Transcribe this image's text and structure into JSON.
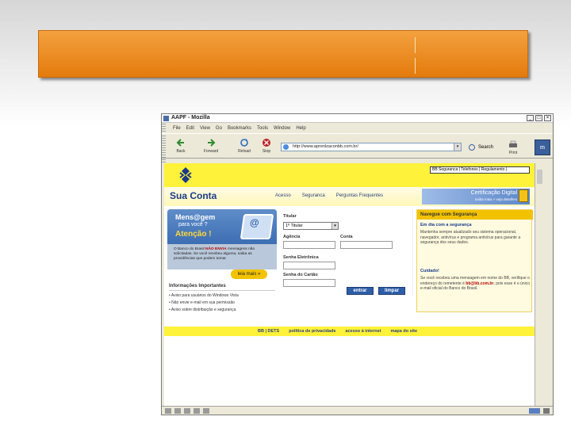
{
  "browser": {
    "title": "AAPF - Mozilla",
    "menu": [
      "File",
      "Edit",
      "View",
      "Go",
      "Bookmarks",
      "Tools",
      "Window",
      "Help"
    ],
    "toolbar": {
      "back": "Back",
      "forward": "Forward",
      "reload": "Reload",
      "stop": "Stop",
      "print": "Print"
    },
    "url": "http://www.aprenlzaconbb.com.br/",
    "search_label": "Search",
    "throbber": "m"
  },
  "page": {
    "top_link": "BB Seguranca | Telefones | Regulamento |",
    "brand": "Sua Conta",
    "nav": [
      "Acesso",
      "Seguranca",
      "Perguntas Frequentes"
    ],
    "cert_title": "Certificação Digital",
    "cert_sub": "saiba mais  »  veja detalhes",
    "promo": {
      "title": "Mens@gem",
      "subtitle": "para você ?",
      "alert": "Atenção !",
      "body_pre": "O Banco do Brasil ",
      "body_bold": "NÃO ENVIA",
      "body_post": " mensagens não solicitadas. Se você recebeu alguma, saiba as providências que podem tomar."
    },
    "leia_mais": "leia mais  »",
    "info_heading": "Informações Importantes",
    "info_items": [
      "• Aviso para usuários do Windows Vista",
      "• Não envie e-mail em sua permissão",
      "• Aviso sobre distribuição e segurança"
    ],
    "form": {
      "titular_label": "Titular",
      "titular_value": "1º Titular",
      "agencia_label": "Agência",
      "conta_label": "Conta",
      "senha_label": "Senha Eletrônica",
      "senha_cartao_label": "Senha do Cartão",
      "entrar": "entrar",
      "limpar": "limpar"
    },
    "right_panel": {
      "header": "Navegue com Segurança",
      "s1": "Em dia com a segurança",
      "t1": "Mantenha sempre atualizado seu sistema operacional, navegador, antivírus e programa antivírus para garantir a segurança dos seus dados.",
      "s2": "Cuidado!",
      "t2_pre": "Se você recebeu uma mensagem em nome do BB, verifique o endereço do remetente é ",
      "t2_bold": "bb@bb.com.br",
      "t2_post": ", pois esse é o único e-mail oficial do Banco do Brasil."
    },
    "footer": [
      "BB  |  DETS",
      "política de privacidade",
      "acesso à internet",
      "mapa do site"
    ]
  },
  "colors": {
    "banner": "#e8841a",
    "bb_yellow": "#fff23a",
    "bb_blue": "#1a3a8a",
    "button_blue": "#2f5ea8"
  }
}
